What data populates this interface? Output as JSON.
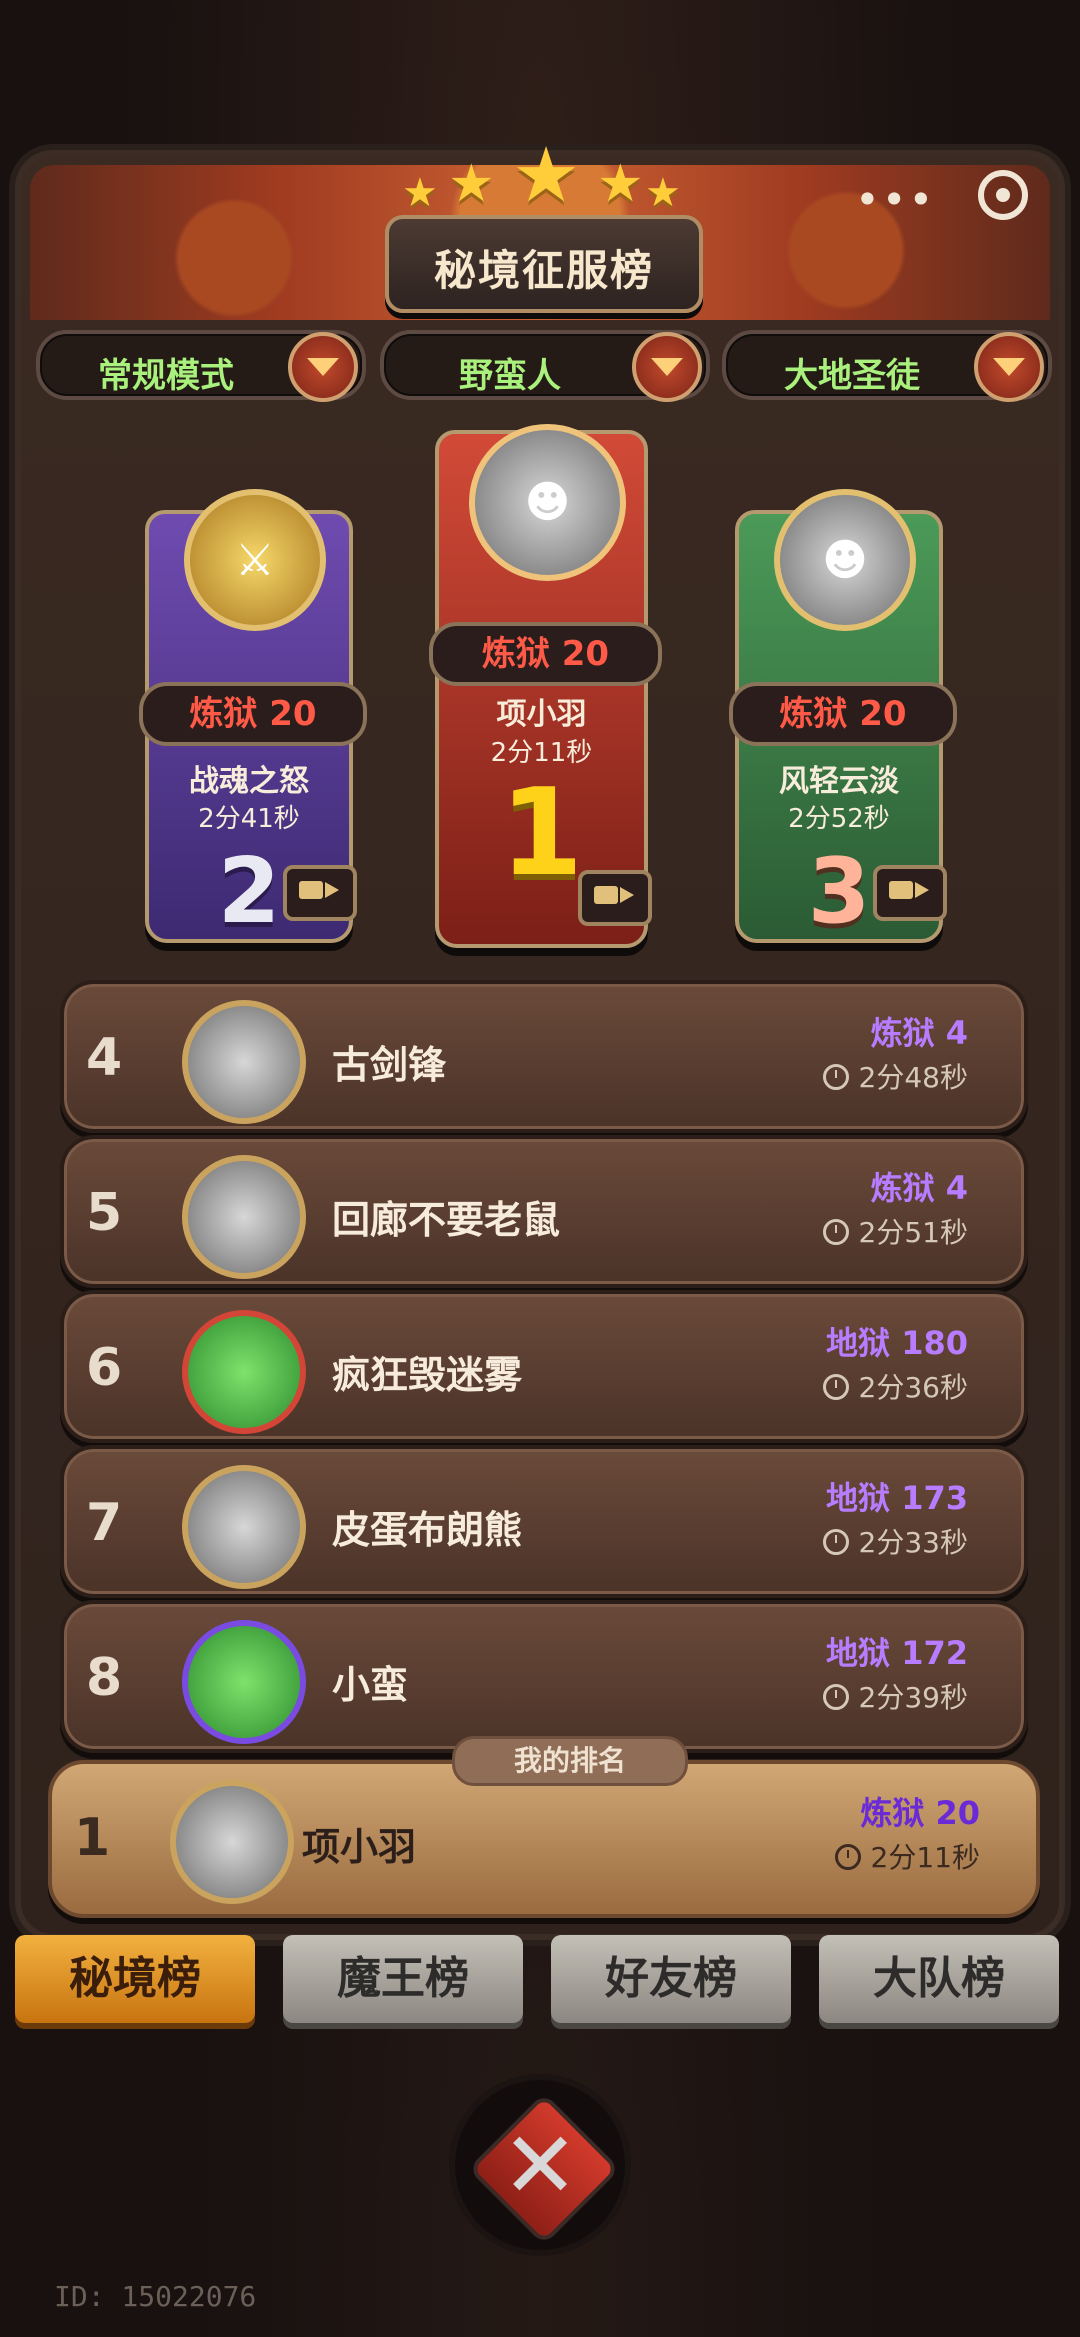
{
  "header": {
    "title": "秘境征服榜",
    "more_icon": "more-icon",
    "settings_icon": "target-icon"
  },
  "filters": [
    {
      "label": "常规模式"
    },
    {
      "label": "野蛮人"
    },
    {
      "label": "大地圣徒"
    }
  ],
  "podium": {
    "first": {
      "rank": "1",
      "level": "炼狱 20",
      "name": "项小羽",
      "time": "2分11秒"
    },
    "second": {
      "rank": "2",
      "level": "炼狱 20",
      "name": "战魂之怒",
      "time": "2分41秒"
    },
    "third": {
      "rank": "3",
      "level": "炼狱 20",
      "name": "风轻云淡",
      "time": "2分52秒"
    }
  },
  "list": [
    {
      "rank": "4",
      "name": "古剑锋",
      "level": "炼狱 4",
      "time": "2分48秒"
    },
    {
      "rank": "5",
      "name": "回廊不要老鼠",
      "level": "炼狱 4",
      "time": "2分51秒"
    },
    {
      "rank": "6",
      "name": "疯狂毁迷雾",
      "level": "地狱 180",
      "time": "2分36秒"
    },
    {
      "rank": "7",
      "name": "皮蛋布朗熊",
      "level": "地狱 173",
      "time": "2分33秒"
    },
    {
      "rank": "8",
      "name": "小蛮",
      "level": "地狱 172",
      "time": "2分39秒"
    }
  ],
  "my_rank": {
    "tag": "我的排名",
    "rank": "1",
    "name": "项小羽",
    "level": "炼狱 20",
    "time": "2分11秒"
  },
  "tabs": [
    {
      "label": "秘境榜"
    },
    {
      "label": "魔王榜"
    },
    {
      "label": "好友榜"
    },
    {
      "label": "大队榜"
    }
  ],
  "footer": {
    "user_id": "ID: 15022076"
  },
  "colors": {
    "level_purple": "#b77cff",
    "red_level": "#ff5a47",
    "active_tab": "#f2b13f"
  }
}
